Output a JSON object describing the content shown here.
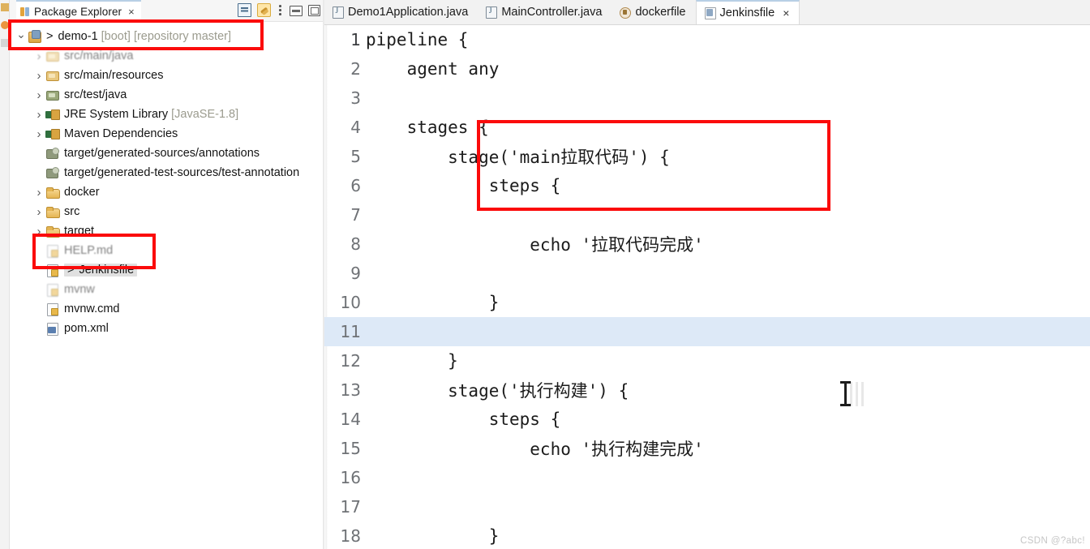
{
  "window": {
    "watermark": "CSDN @?abc!"
  },
  "left_rail": {
    "icons": [
      "perspective-icon",
      "marker-icon",
      "outline-icon"
    ]
  },
  "explorer": {
    "tab_title": "Package Explorer",
    "tab_close": "×",
    "tools": [
      {
        "name": "collapse-all-button",
        "label": "Collapse All"
      },
      {
        "name": "link-with-editor-button",
        "label": "Link with Editor"
      },
      {
        "name": "view-menu-button",
        "label": "View Menu"
      },
      {
        "name": "minimize-button",
        "label": "Minimize"
      },
      {
        "name": "maximize-button",
        "label": "Maximize"
      }
    ],
    "tree": [
      {
        "twisty": "open",
        "icon": "project-icon",
        "marker": ">",
        "label": "demo-1",
        "sub": "[boot] [repository master]",
        "indent": 0,
        "selected": false,
        "ghost": "none"
      },
      {
        "twisty": "closed",
        "icon": "source-package-icon",
        "marker": "",
        "label": "src/main/java",
        "sub": "",
        "indent": 1,
        "selected": false,
        "ghost": "strong"
      },
      {
        "twisty": "closed",
        "icon": "source-package-icon",
        "marker": "",
        "label": "src/main/resources",
        "sub": "",
        "indent": 1,
        "selected": false,
        "ghost": "none"
      },
      {
        "twisty": "closed",
        "icon": "test-package-icon",
        "marker": "",
        "label": "src/test/java",
        "sub": "",
        "indent": 1,
        "selected": false,
        "ghost": "none"
      },
      {
        "twisty": "closed",
        "icon": "library-icon",
        "marker": "",
        "label": "JRE System Library",
        "sub": "[JavaSE-1.8]",
        "indent": 1,
        "selected": false,
        "ghost": "none"
      },
      {
        "twisty": "closed",
        "icon": "library-icon",
        "marker": "",
        "label": "Maven Dependencies",
        "sub": "",
        "indent": 1,
        "selected": false,
        "ghost": "none"
      },
      {
        "twisty": "none",
        "icon": "generated-folder-icon",
        "marker": "",
        "label": "target/generated-sources/annotations",
        "sub": "",
        "indent": 1,
        "selected": false,
        "ghost": "none"
      },
      {
        "twisty": "none",
        "icon": "generated-folder-icon",
        "marker": "",
        "label": "target/generated-test-sources/test-annotation",
        "sub": "",
        "indent": 1,
        "selected": false,
        "ghost": "none"
      },
      {
        "twisty": "closed",
        "icon": "folder-icon",
        "marker": "",
        "label": "docker",
        "sub": "",
        "indent": 1,
        "selected": false,
        "ghost": "none"
      },
      {
        "twisty": "closed",
        "icon": "folder-icon",
        "marker": "",
        "label": "src",
        "sub": "",
        "indent": 1,
        "selected": false,
        "ghost": "none"
      },
      {
        "twisty": "closed",
        "icon": "folder-icon",
        "marker": "",
        "label": "target",
        "sub": "",
        "indent": 1,
        "selected": false,
        "ghost": "none"
      },
      {
        "twisty": "none",
        "icon": "file-icon",
        "marker": "",
        "label": "HELP.md",
        "sub": "",
        "indent": 1,
        "selected": false,
        "ghost": "strong"
      },
      {
        "twisty": "none",
        "icon": "file-icon",
        "marker": ">",
        "label": "Jenkinsfile",
        "sub": "",
        "indent": 1,
        "selected": true,
        "ghost": "none"
      },
      {
        "twisty": "none",
        "icon": "file-icon",
        "marker": "",
        "label": "mvnw",
        "sub": "",
        "indent": 1,
        "selected": false,
        "ghost": "strong"
      },
      {
        "twisty": "none",
        "icon": "file-icon",
        "marker": "",
        "label": "mvnw.cmd",
        "sub": "",
        "indent": 1,
        "selected": false,
        "ghost": "none"
      },
      {
        "twisty": "none",
        "icon": "xml-file-icon",
        "marker": "",
        "label": "pom.xml",
        "sub": "",
        "indent": 1,
        "selected": false,
        "ghost": "none"
      }
    ]
  },
  "editor": {
    "tabs": [
      {
        "label": "Demo1Application.java",
        "icon": "java-file-icon",
        "active": false,
        "closable": false
      },
      {
        "label": "MainController.java",
        "icon": "java-file-icon",
        "active": false,
        "closable": false
      },
      {
        "label": "dockerfile",
        "icon": "docker-file-icon",
        "active": false,
        "closable": false
      },
      {
        "label": "Jenkinsfile",
        "icon": "jenkins-file-icon",
        "active": true,
        "closable": true
      }
    ],
    "tab_close_glyph": "×",
    "current_line": 11,
    "lines": [
      {
        "no": "1",
        "text": "pipeline {"
      },
      {
        "no": "2",
        "text": "    agent any"
      },
      {
        "no": "3",
        "text": ""
      },
      {
        "no": "4",
        "text": "    stages {"
      },
      {
        "no": "5",
        "text": "        stage('main拉取代码') {"
      },
      {
        "no": "6",
        "text": "            steps {"
      },
      {
        "no": "7",
        "text": ""
      },
      {
        "no": "8",
        "text": "                echo '拉取代码完成'"
      },
      {
        "no": "9",
        "text": ""
      },
      {
        "no": "10",
        "text": "            }"
      },
      {
        "no": "11",
        "text": ""
      },
      {
        "no": "12",
        "text": "        }"
      },
      {
        "no": "13",
        "text": "        stage('执行构建') {"
      },
      {
        "no": "14",
        "text": "            steps {"
      },
      {
        "no": "15",
        "text": "                echo '执行构建完成'"
      },
      {
        "no": "16",
        "text": ""
      },
      {
        "no": "17",
        "text": ""
      },
      {
        "no": "18",
        "text": "            }"
      }
    ]
  },
  "annotations": {
    "color": "#fb0b0b",
    "boxes": [
      {
        "name": "annotation-box-project",
        "target": "demo-1 project row"
      },
      {
        "name": "annotation-box-jenkinsfile",
        "target": "Jenkinsfile tree item"
      },
      {
        "name": "annotation-box-stage-block",
        "target": "stage('main拉取代码') steps block"
      }
    ]
  },
  "cursor": {
    "type": "text-ibeam"
  }
}
